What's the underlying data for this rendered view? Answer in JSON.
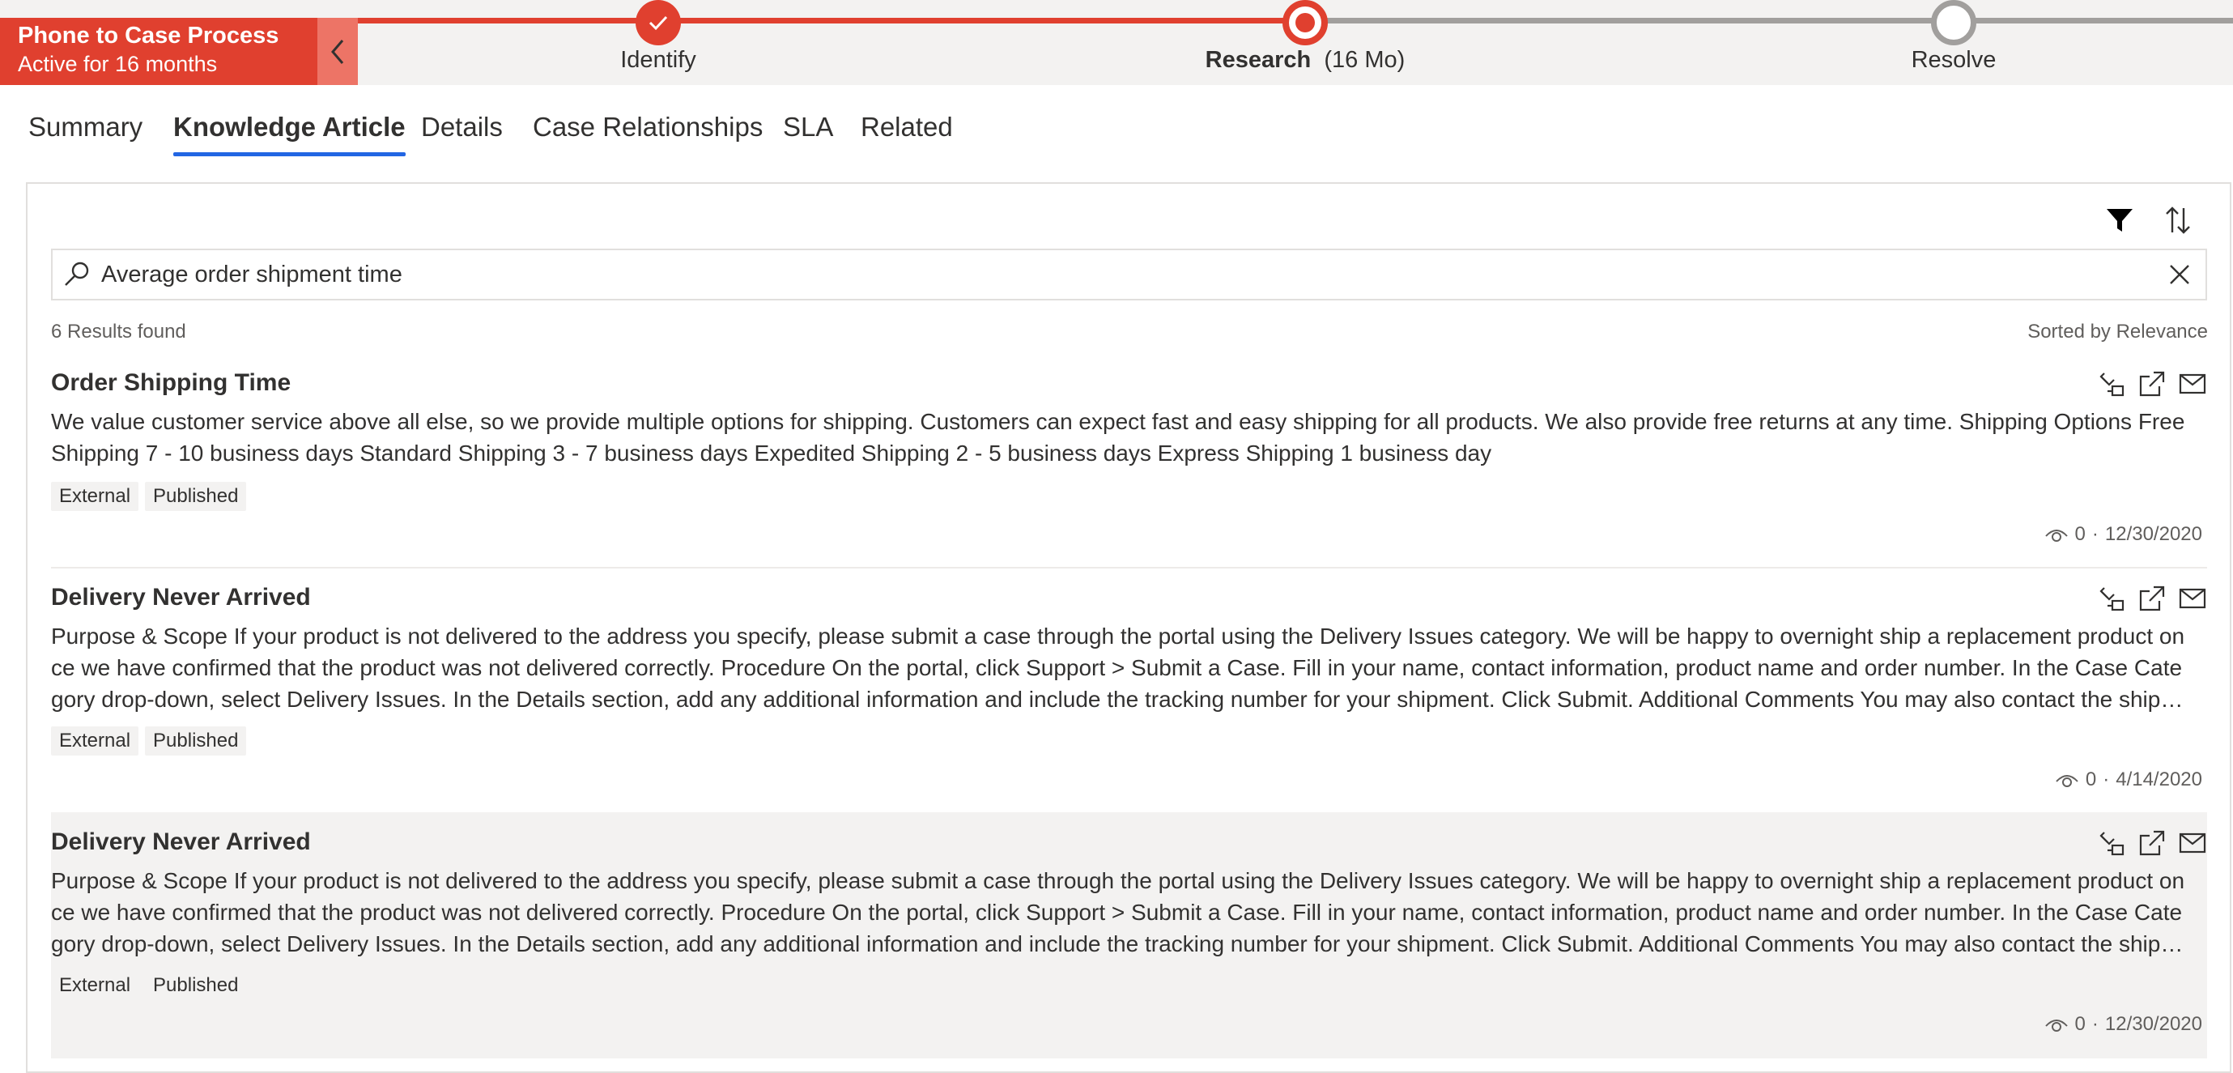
{
  "process": {
    "name": "Phone to Case Process",
    "active_for": "Active for 16 months",
    "stages": [
      {
        "label": "Identify",
        "duration": "",
        "status": "completed"
      },
      {
        "label": "Research",
        "duration": "(16 Mo)",
        "status": "active"
      },
      {
        "label": "Resolve",
        "duration": "",
        "status": "pending"
      }
    ],
    "accent_color": "#e0402f"
  },
  "tabs": [
    {
      "label": "Summary",
      "active": false
    },
    {
      "label": "Knowledge Article",
      "active": true
    },
    {
      "label": "Details",
      "active": false
    },
    {
      "label": "Case Relationships",
      "active": false
    },
    {
      "label": "SLA",
      "active": false
    },
    {
      "label": "Related",
      "active": false
    }
  ],
  "toolbar": {
    "filter_icon": "filter-icon",
    "sort_icon": "sort-icon"
  },
  "search": {
    "value": "Average order shipment time"
  },
  "results": {
    "count_text": "6 Results found",
    "sort_text": "Sorted by Relevance"
  },
  "articles": [
    {
      "title": "Order Shipping Time",
      "body": "We value customer service above all else, so we provide multiple options for shipping. Customers can expect fast and easy shipping for all products. We also provide free returns at any time. Shipping Options Free Shipping 7 - 10 business days Standard Shipping 3 - 7 business days Expedited Shipping 2 - 5 business days Express Shipping 1 business day",
      "tags": [
        "External",
        "Published"
      ],
      "views": "0",
      "separator": "·",
      "date": "12/30/2020"
    },
    {
      "title": "Delivery Never Arrived",
      "body": "Purpose & Scope If your product is not delivered to the address you specify, please submit a case through the portal using the Delivery Issues category. We will be happy to overnight ship a replacement product once we have confirmed that the product was not delivered correctly. Procedure On the portal, click Support > Submit a Case. Fill in your name, contact information, product name and order number. In the Case Category drop-down, select Delivery Issues. In the Details section, add any additional information and include the tracking number for your shipment. Click Submit. Additional Comments You may also contact the shipping carrier directly.",
      "tags": [
        "External",
        "Published"
      ],
      "views": "0",
      "separator": "·",
      "date": "4/14/2020"
    },
    {
      "title": "Delivery Never Arrived",
      "body": "Purpose & Scope If your product is not delivered to the address you specify, please submit a case through the portal using the Delivery Issues category. We will be happy to overnight ship a replacement product once we have confirmed that the product was not delivered correctly. Procedure On the portal, click Support > Submit a Case. Fill in your name, contact information, product name and order number. In the Case Category drop-down, select Delivery Issues. In the Details section, add any additional information and include the tracking number for your shipment. Click Submit. Additional Comments You may also contact the shipping carrier directly.",
      "tags": [
        "External",
        "Published"
      ],
      "views": "0",
      "separator": "·",
      "date": "12/30/2020"
    }
  ]
}
